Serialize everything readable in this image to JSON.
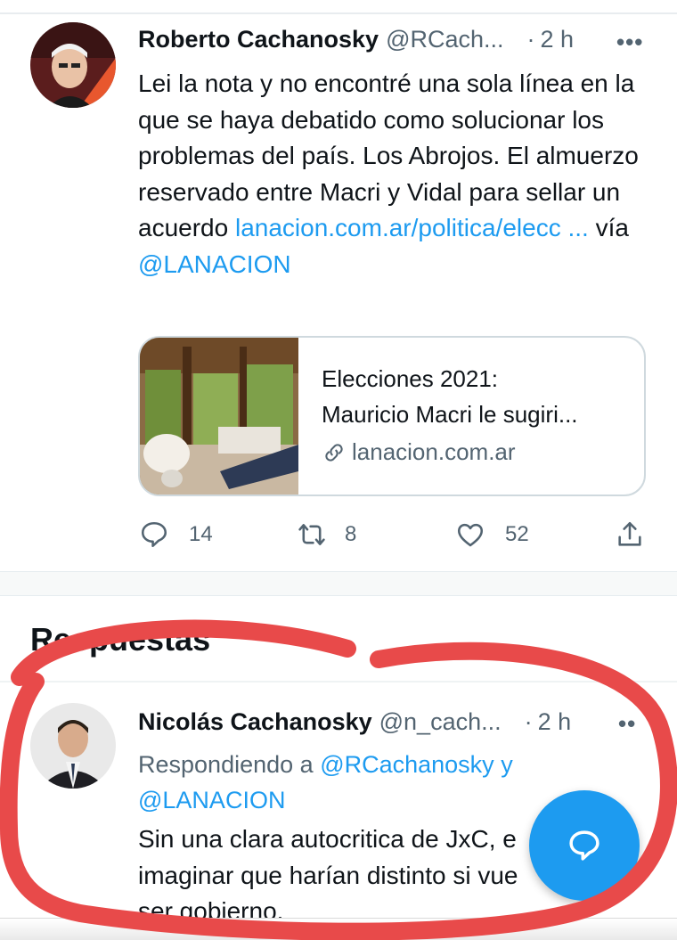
{
  "tweet": {
    "author_name": "Roberto Cachanosky",
    "author_handle": "@RCach...",
    "separator": "·",
    "time": "2 h",
    "more": "•••",
    "text_before_link": "Lei la nota y no encontré una sola línea en la que se haya debatido como solucionar los problemas del país. Los Abrojos. El almuerzo reservado entre Macri y Vidal para sellar un acuerdo",
    "link_text": "lanacion.com.ar/politica/elecc ...",
    "via_text": "vía",
    "mention": "@LANACION",
    "card": {
      "title_line1": "Elecciones 2021:",
      "title_line2": "Mauricio Macri le sugiri...",
      "domain": "lanacion.com.ar"
    },
    "actions": {
      "replies": "14",
      "retweets": "8",
      "likes": "52"
    }
  },
  "section": {
    "title": "Respuestas"
  },
  "reply": {
    "author_name": "Nicolás Cachanosky",
    "author_handle": "@n_cach...",
    "separator": "·",
    "time": "2 h",
    "more": "••",
    "replying_prefix": "Respondiendo a",
    "replying_to_1": "@RCachanosky",
    "replying_and": "y",
    "replying_to_2": "@LANACION",
    "text_line1": "Sin una clara autocritica de JxC, e",
    "text_line2": "imaginar que harían distinto si vue",
    "text_line3": "ser gobierno."
  },
  "icons": {
    "reply": "reply-icon",
    "retweet": "retweet-icon",
    "like": "heart-icon",
    "share": "share-icon",
    "link": "link-icon",
    "compose": "compose-reply-icon"
  },
  "colors": {
    "accent": "#1d9bf0",
    "text_primary": "#0f1419",
    "text_secondary": "#536471",
    "annotation": "#e84a4a"
  }
}
